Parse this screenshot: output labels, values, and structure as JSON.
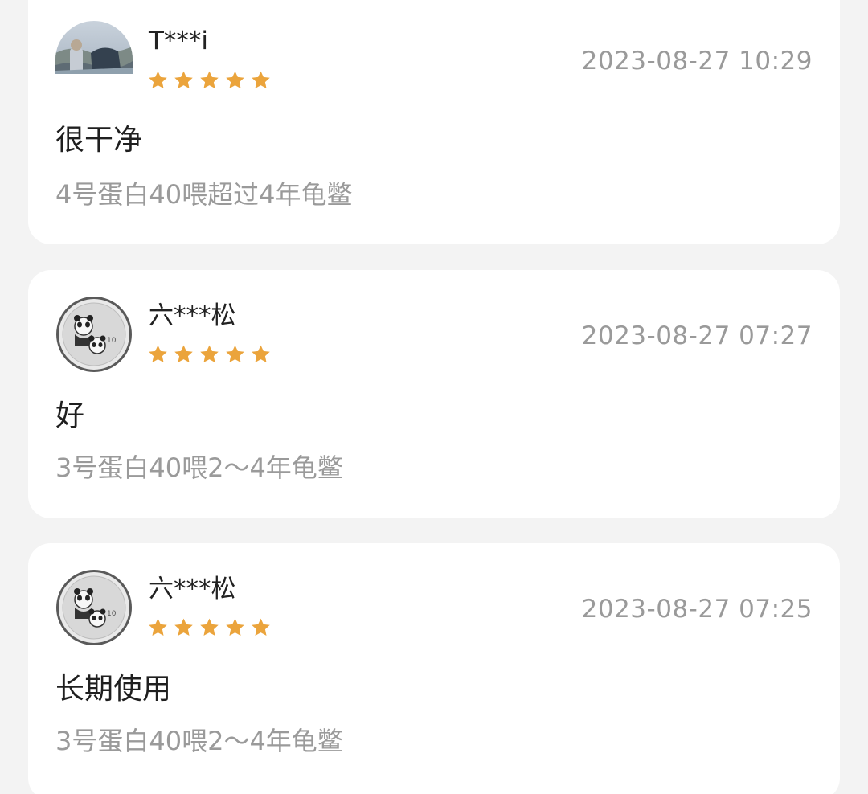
{
  "reviews": [
    {
      "username": "T***i",
      "rating": 5,
      "timestamp": "2023-08-27 10:29",
      "text": "很干净",
      "variant": "4号蛋白40喂超过4年龟鳖",
      "avatar_icon": "landscape-photo-avatar"
    },
    {
      "username": "六***松",
      "rating": 5,
      "timestamp": "2023-08-27 07:27",
      "text": "好",
      "variant": "3号蛋白40喂2～4年龟鳖",
      "avatar_icon": "panda-coin-avatar"
    },
    {
      "username": "六***松",
      "rating": 5,
      "timestamp": "2023-08-27 07:25",
      "text": "长期使用",
      "variant": "3号蛋白40喂2～4年龟鳖",
      "avatar_icon": "panda-coin-avatar"
    }
  ],
  "colors": {
    "star": "#eba43c",
    "background": "#f3f3f3",
    "card": "#ffffff",
    "muted_text": "#9a9a9a",
    "primary_text": "#1f1f1f"
  }
}
